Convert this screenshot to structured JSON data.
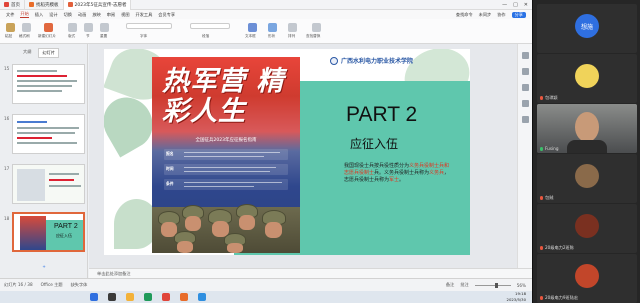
{
  "titlebar": {
    "tabs": [
      {
        "label": "首页",
        "active": false
      },
      {
        "label": "找稻壳模板",
        "active": false
      },
      {
        "label": "2023年5征兵宣传-志愿者",
        "active": true
      }
    ],
    "buttons": [
      "—",
      "□",
      "✕"
    ]
  },
  "ribbon": {
    "tabs": [
      "文件",
      "开始",
      "插入",
      "设计",
      "切换",
      "动画",
      "放映",
      "审阅",
      "视图",
      "开发工具",
      "会员专享"
    ],
    "active_tab": "开始",
    "right": [
      "查找命令",
      "未同步",
      "协作",
      "分享"
    ],
    "tool_labels": [
      "粘贴",
      "格式刷",
      "新建幻灯片",
      "版式",
      "节",
      "重置",
      "字体",
      "段落",
      "文本框",
      "形状",
      "排列",
      "查找替换"
    ]
  },
  "thumbnail_panel": {
    "tabs": [
      "大纲",
      "幻灯片"
    ],
    "active_tab": "幻灯片",
    "slide_numbers": [
      "15",
      "16",
      "17",
      "18"
    ],
    "thumb_part": "PART 2",
    "thumb_section": "应征入伍",
    "add_hint": "+"
  },
  "slide": {
    "school_name": "广西水利电力职业技术学院",
    "poster_title": "热军营 精彩人生",
    "poster_subtitle": "全国征兵2023年应征报名指南",
    "poster_rows": [
      "报名",
      "时间",
      "条件"
    ],
    "part": "PART 2",
    "section": "应征入伍",
    "body_pre": "我国现役士兵按兵役性质分为",
    "body_red1": "义务兵役制士兵和志愿兵役制士",
    "body_mid": "兵。义务兵役制士兵称为",
    "body_red2": "义务兵",
    "body_post": "，志愿兵役制士兵称为",
    "body_red3": "军士",
    "body_end": "。"
  },
  "notes": {
    "placeholder": "单击此处添加备注"
  },
  "statusbar": {
    "slide_counter": "幻灯片 16 / 38",
    "theme": "Office 主题",
    "zoom": "56%",
    "left_items": [
      "缺失字体"
    ],
    "right_items": [
      "备注",
      "批注"
    ]
  },
  "taskbar": {
    "time": "19:18",
    "date": "2023/5/30"
  },
  "meeting": {
    "participants": [
      {
        "name": "",
        "avatar_text": "想施",
        "avatar_color": "#2f6fe0",
        "mic_on": false
      },
      {
        "name": "包琪颖",
        "avatar_text": "",
        "avatar_color": "#f0d35a",
        "mic_on": false
      },
      {
        "name": "Fusing",
        "avatar_text": "",
        "avatar_color": "#444444",
        "mic_on": true,
        "video": true
      },
      {
        "name": "包贼",
        "avatar_text": "",
        "avatar_color": "#8a6a4a",
        "mic_on": false
      },
      {
        "name": "20级电力2班陈",
        "avatar_text": "",
        "avatar_color": "#7a3020",
        "mic_on": false
      },
      {
        "name": "20级电力9班陆宏",
        "avatar_text": "",
        "avatar_color": "#c2462a",
        "mic_on": false
      }
    ]
  }
}
